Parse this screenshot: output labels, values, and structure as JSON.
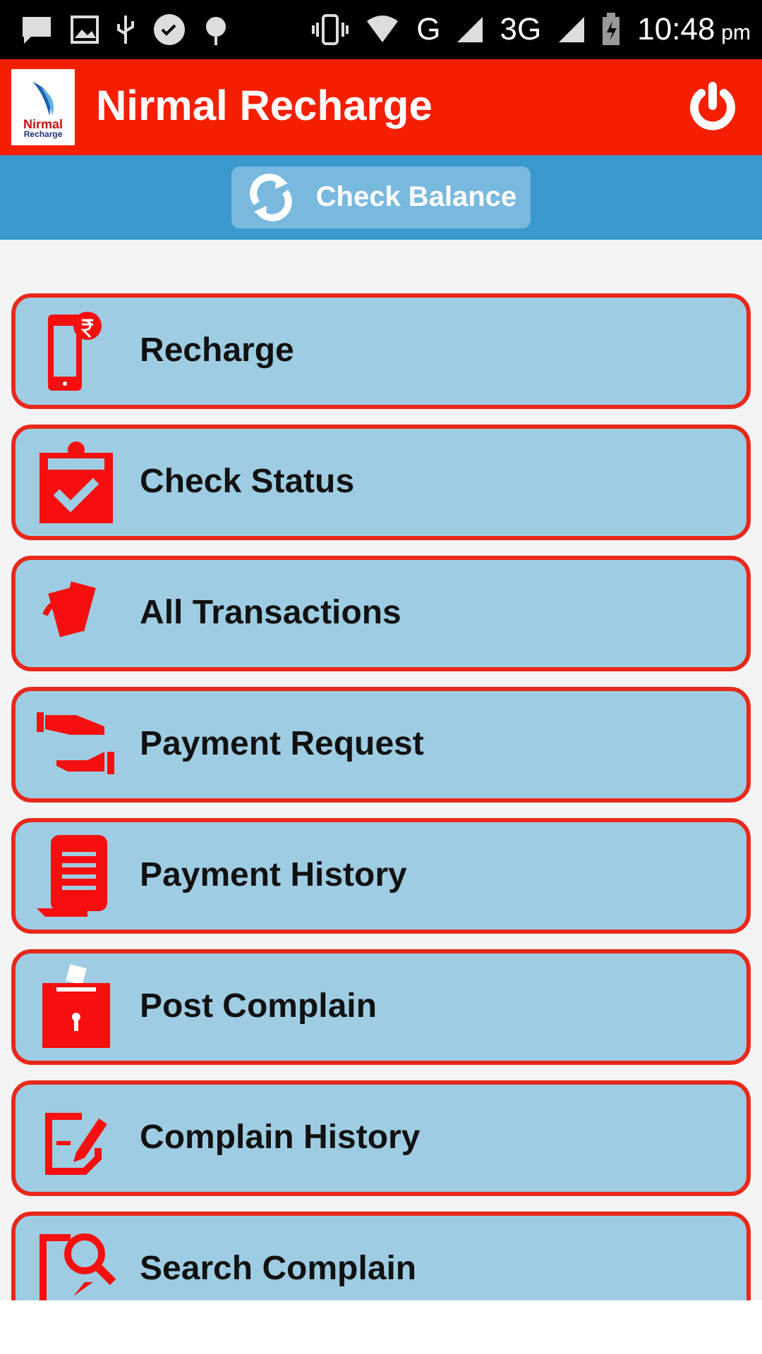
{
  "status_bar": {
    "network_1": "G",
    "network_2": "3G",
    "time": "10:48",
    "time_suffix": "pm"
  },
  "app_bar": {
    "logo_top": "Nirmal",
    "logo_bottom": "Recharge",
    "title": "Nirmal Recharge"
  },
  "balance_button": {
    "label": "Check Balance"
  },
  "menu": [
    {
      "label": "Recharge"
    },
    {
      "label": "Check Status"
    },
    {
      "label": "All Transactions"
    },
    {
      "label": "Payment Request"
    },
    {
      "label": "Payment History"
    },
    {
      "label": "Post Complain"
    },
    {
      "label": "Complain History"
    },
    {
      "label": "Search Complain"
    }
  ]
}
